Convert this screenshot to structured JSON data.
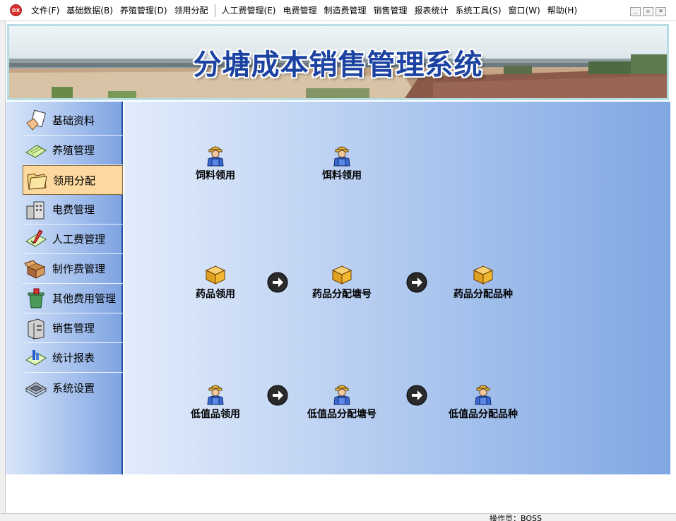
{
  "app": {
    "icon_label": "DX"
  },
  "menu": {
    "items": [
      "文件(F)",
      "基础数据(B)",
      "养殖管理(D)",
      "领用分配",
      "人工费管理(E)",
      "电费管理",
      "制造费管理",
      "销售管理",
      "报表统计",
      "系统工具(S)",
      "窗口(W)",
      "帮助(H)"
    ],
    "window_controls": [
      "_",
      "▫",
      "×"
    ]
  },
  "banner": {
    "title": "分塘成本销售管理系统"
  },
  "sidebar": {
    "items": [
      {
        "label": "基础资料",
        "icon": "hand-document-icon",
        "active": false
      },
      {
        "label": "养殖管理",
        "icon": "notepad-pen-icon",
        "active": false
      },
      {
        "label": "领用分配",
        "icon": "folder-open-icon",
        "active": true
      },
      {
        "label": "电费管理",
        "icon": "buildings-icon",
        "active": false
      },
      {
        "label": "人工费管理",
        "icon": "checklist-pen-icon",
        "active": false
      },
      {
        "label": "制作费管理",
        "icon": "open-box-icon",
        "active": false
      },
      {
        "label": "其他费用管理",
        "icon": "recycle-bin-icon",
        "active": false
      },
      {
        "label": "销售管理",
        "icon": "server-cabinet-icon",
        "active": false
      },
      {
        "label": "统计报表",
        "icon": "chart-notepad-icon",
        "active": false
      },
      {
        "label": "系统设置",
        "icon": "settings-tray-icon",
        "active": false
      }
    ]
  },
  "main": {
    "nodes": {
      "feed1": "饲料领用",
      "feed2": "饵料领用",
      "med_use": "药品领用",
      "med_pond": "药品分配塘号",
      "med_species": "药品分配品种",
      "low_use": "低值品领用",
      "low_pond": "低值品分配塘号",
      "low_species": "低值品分配品种"
    }
  },
  "status": {
    "operator": "操作员：BOSS"
  },
  "colors": {
    "title_blue": "#1c43a2",
    "sidebar_active": "#fdd9a0",
    "border_blue": "#1f4fa8"
  }
}
